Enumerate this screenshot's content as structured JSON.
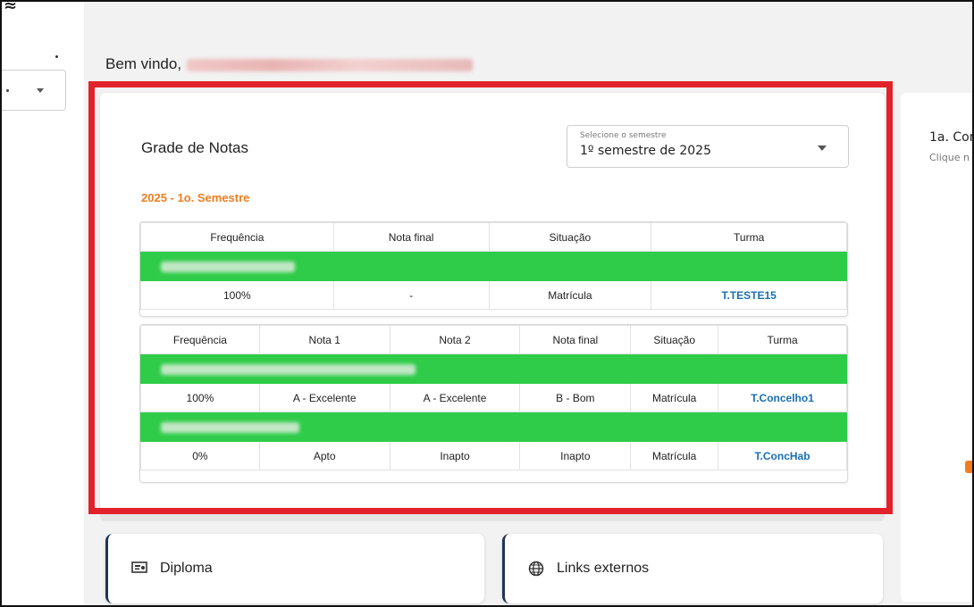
{
  "welcome": {
    "prefix": "Bem vindo,"
  },
  "grade": {
    "title": "Grade de Notas",
    "semester_select": {
      "label": "Selecione o semestre",
      "value": "1º semestre de 2025"
    },
    "semester_heading": "2025 - 1o. Semestre",
    "table1": {
      "headers": [
        "Frequência",
        "Nota final",
        "Situação",
        "Turma"
      ],
      "rows": [
        {
          "frequencia": "100%",
          "nota_final": "-",
          "situacao": "Matrícula",
          "turma": "T.TESTE15"
        }
      ]
    },
    "table2": {
      "headers": [
        "Frequência",
        "Nota 1",
        "Nota 2",
        "Nota final",
        "Situação",
        "Turma"
      ],
      "rows": [
        {
          "frequencia": "100%",
          "nota1": "A - Excelente",
          "nota2": "A - Excelente",
          "nota_final": "B - Bom",
          "situacao": "Matrícula",
          "turma": "T.Concelho1"
        },
        {
          "frequencia": "0%",
          "nota1": "Apto",
          "nota2": "Inapto",
          "nota_final": "Inapto",
          "situacao": "Matrícula",
          "turma": "T.ConcHab"
        }
      ]
    }
  },
  "right_card": {
    "title": "1a. Con",
    "subtitle": "Clique n"
  },
  "bottom_cards": [
    {
      "label": "Diploma",
      "icon": "diploma-icon"
    },
    {
      "label": "Links externos",
      "icon": "globe-icon"
    }
  ],
  "colors": {
    "highlight": "#e2222a",
    "subject_bar": "#2ecc48",
    "semester_heading": "#f07e1e",
    "link": "#1b6fb4"
  }
}
